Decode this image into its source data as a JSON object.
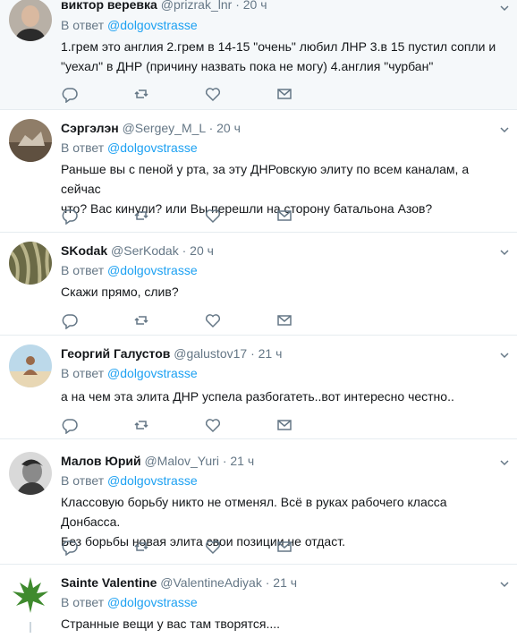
{
  "tweets": [
    {
      "name": "виктор веревка",
      "handle": "@prizrak_lnr",
      "time": "20 ч",
      "reply_prefix": "В ответ",
      "reply_to": "@dolgovstrasse",
      "lines": [
        "1.грем это англия  2.грем в 14-15 \"очень\" любил ЛНР    3.в 15 пустил сопли и",
        "\"уехал\" в ДНР (причину назвать пока не могу) 4.англия \"чурбан\""
      ]
    },
    {
      "name": "Сэргэлэн",
      "handle": "@Sergey_M_L",
      "time": "20 ч",
      "reply_prefix": "В ответ",
      "reply_to": "@dolgovstrasse",
      "lines": [
        "Раньше вы с пеной у рта, за эту ДНРовскую элиту по всем каналам, а сейчас",
        "что? Вас кинули? или Вы перешли на сторону батальона Азов?"
      ]
    },
    {
      "name": "SKodak",
      "handle": "@SerKodak",
      "time": "20 ч",
      "reply_prefix": "В ответ",
      "reply_to": "@dolgovstrasse",
      "lines": [
        "Скажи прямо, слив?"
      ]
    },
    {
      "name": "Георгий Галустов",
      "handle": "@galustov17",
      "time": "21 ч",
      "reply_prefix": "В ответ",
      "reply_to": "@dolgovstrasse",
      "lines": [
        "а на чем эта элита ДНР успела разбогатеть..вот интересно честно.."
      ]
    },
    {
      "name": "Малов Юрий",
      "handle": "@Malov_Yuri",
      "time": "21 ч",
      "reply_prefix": "В ответ",
      "reply_to": "@dolgovstrasse",
      "lines": [
        "Классовую борьбу никто не отменял. Всё в руках рабочего класса Донбасса.",
        "Без борьбы новая элита свои позиции не отдаст."
      ]
    },
    {
      "name": "Sainte Valentine",
      "handle": "@ValentineAdiyak",
      "time": "21 ч",
      "reply_prefix": "В ответ",
      "reply_to": "@dolgovstrasse",
      "lines": [
        "Странные вещи у вас там творятся...."
      ]
    }
  ],
  "separator": "·"
}
